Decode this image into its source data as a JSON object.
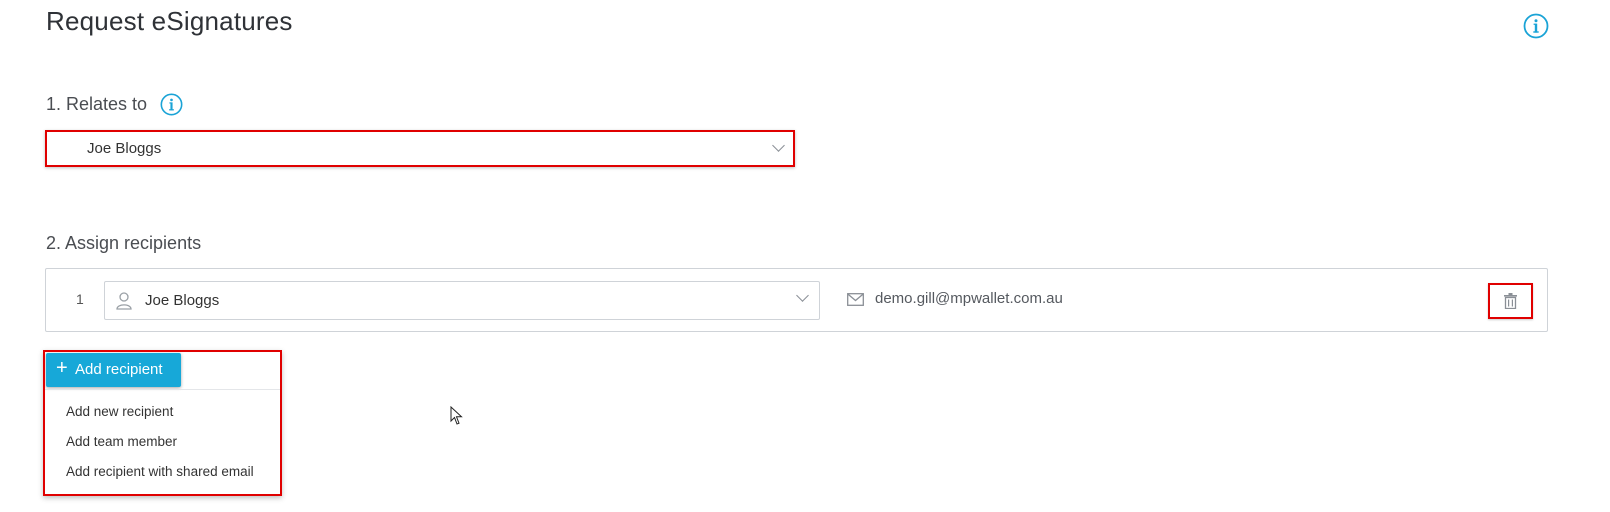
{
  "page": {
    "title": "Request eSignatures",
    "info_icon": "info-icon"
  },
  "section1": {
    "label": "1. Relates to",
    "info_icon": "info-icon",
    "select_value": "Joe Bloggs"
  },
  "section2": {
    "label": "2. Assign recipients",
    "recipients": [
      {
        "number": "1",
        "name": "Joe Bloggs",
        "email": "demo.gill@mpwallet.com.au",
        "icons": [
          "person-icon",
          "mail-icon",
          "trash-icon"
        ]
      }
    ]
  },
  "add_recipient": {
    "button_label": "Add recipient",
    "plus": "+",
    "menu_items": [
      "Add new recipient",
      "Add team member",
      "Add recipient with shared email"
    ]
  },
  "colors": {
    "accent": "#17a8d8",
    "highlight_border": "#e00000",
    "info_icon": "#1aa3d6"
  }
}
